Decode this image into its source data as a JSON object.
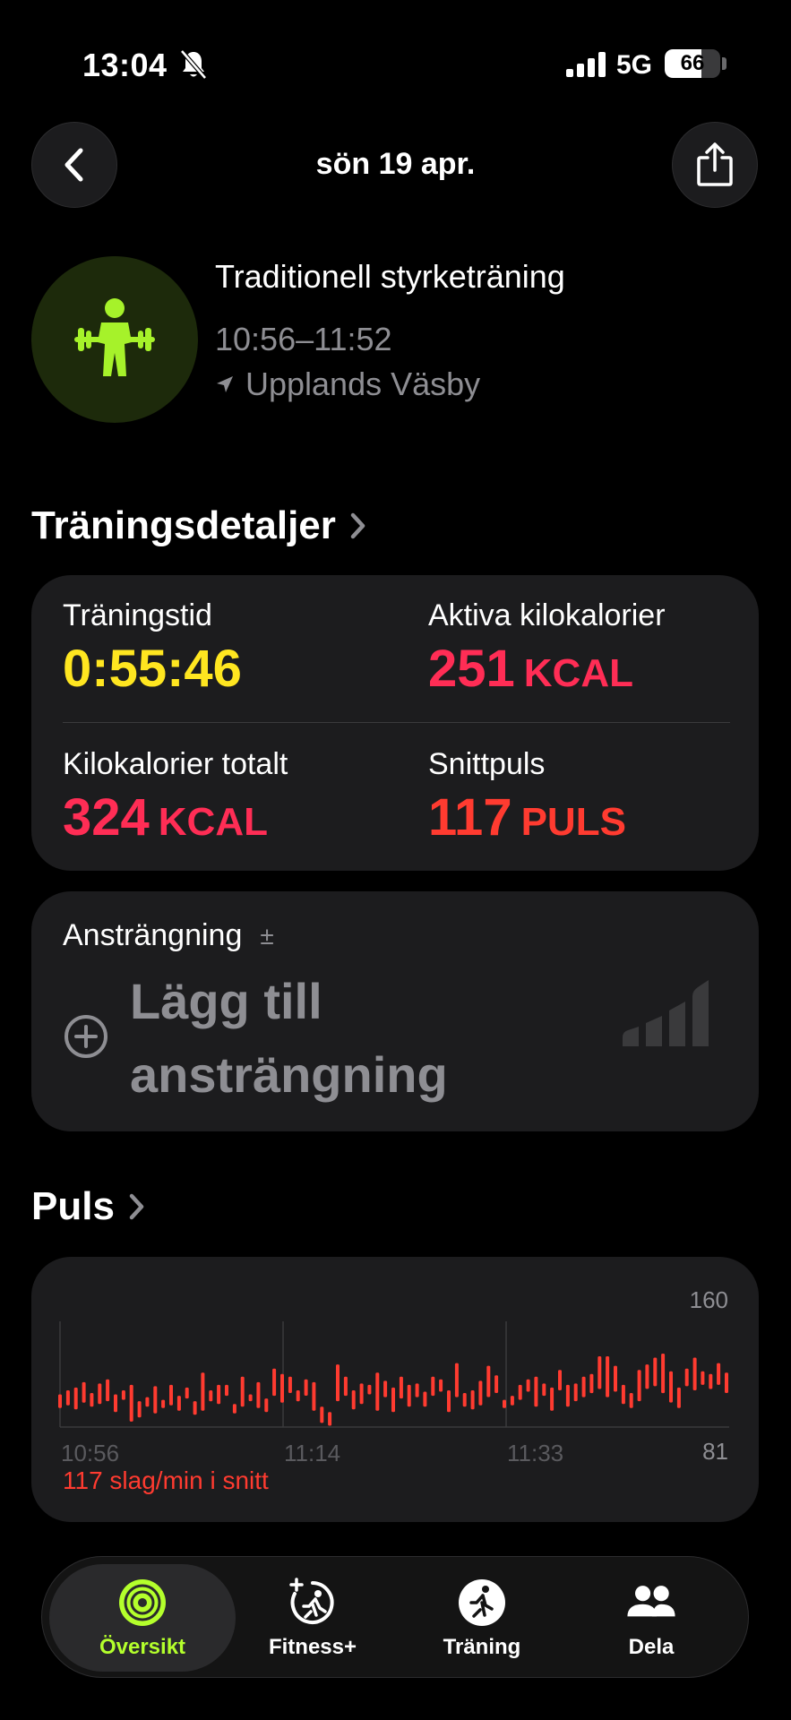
{
  "status_bar": {
    "time": "13:04",
    "network": "5G",
    "battery": "66",
    "battery_level": 0.66
  },
  "nav": {
    "title": "sön 19 apr."
  },
  "workout": {
    "name": "Traditionell styrketräning",
    "time_range": "10:56–11:52",
    "location": "Upplands Väsby"
  },
  "details": {
    "header": "Träningsdetaljer",
    "metrics": [
      {
        "label": "Träningstid",
        "value": "0:55:46",
        "unit": "",
        "color": "#ffe620"
      },
      {
        "label": "Aktiva kilokalorier",
        "value": "251",
        "unit": "KCAL",
        "color": "#ff2d55"
      },
      {
        "label": "Kilokalorier totalt",
        "value": "324",
        "unit": "KCAL",
        "color": "#ff2d55"
      },
      {
        "label": "Snittpuls",
        "value": "117",
        "unit": "PULS",
        "color": "#ff3b30"
      }
    ]
  },
  "effort": {
    "label": "Ansträngning",
    "plusminus": "±",
    "add_text": "Lägg till ansträngning"
  },
  "pulse": {
    "header": "Puls",
    "average_text": "117 slag/min i snitt",
    "chart_data": {
      "type": "bar",
      "y_max_label": "160",
      "y_min_label": "81",
      "ylim": [
        81,
        160
      ],
      "x_tick_labels": [
        "10:56",
        "11:14",
        "11:33"
      ],
      "series_color": "#ff3b30",
      "ranges": [
        [
          95,
          105
        ],
        [
          97,
          108
        ],
        [
          94,
          110
        ],
        [
          99,
          114
        ],
        [
          96,
          106
        ],
        [
          98,
          113
        ],
        [
          100,
          116
        ],
        [
          92,
          105
        ],
        [
          101,
          108
        ],
        [
          85,
          112
        ],
        [
          88,
          100
        ],
        [
          96,
          103
        ],
        [
          91,
          111
        ],
        [
          95,
          101
        ],
        [
          97,
          112
        ],
        [
          93,
          104
        ],
        [
          102,
          110
        ],
        [
          90,
          100
        ],
        [
          93,
          121
        ],
        [
          100,
          108
        ],
        [
          98,
          112
        ],
        [
          104,
          112
        ],
        [
          91,
          98
        ],
        [
          96,
          118
        ],
        [
          100,
          105
        ],
        [
          95,
          114
        ],
        [
          92,
          102
        ],
        [
          104,
          124
        ],
        [
          99,
          120
        ],
        [
          106,
          118
        ],
        [
          100,
          108
        ],
        [
          104,
          116
        ],
        [
          93,
          114
        ],
        [
          84,
          96
        ],
        [
          82,
          92
        ],
        [
          100,
          127
        ],
        [
          104,
          118
        ],
        [
          94,
          108
        ],
        [
          98,
          113
        ],
        [
          105,
          112
        ],
        [
          93,
          121
        ],
        [
          103,
          115
        ],
        [
          92,
          110
        ],
        [
          102,
          118
        ],
        [
          96,
          112
        ],
        [
          103,
          113
        ],
        [
          96,
          107
        ],
        [
          104,
          118
        ],
        [
          107,
          116
        ],
        [
          92,
          108
        ],
        [
          103,
          128
        ],
        [
          96,
          106
        ],
        [
          94,
          108
        ],
        [
          97,
          115
        ],
        [
          103,
          126
        ],
        [
          106,
          119
        ],
        [
          95,
          101
        ],
        [
          97,
          104
        ],
        [
          101,
          112
        ],
        [
          107,
          116
        ],
        [
          96,
          118
        ],
        [
          104,
          113
        ],
        [
          93,
          110
        ],
        [
          108,
          123
        ],
        [
          96,
          112
        ],
        [
          100,
          113
        ],
        [
          103,
          118
        ],
        [
          106,
          120
        ],
        [
          109,
          133
        ],
        [
          103,
          133
        ],
        [
          107,
          126
        ],
        [
          98,
          112
        ],
        [
          95,
          106
        ],
        [
          100,
          123
        ],
        [
          109,
          127
        ],
        [
          111,
          132
        ],
        [
          106,
          135
        ],
        [
          99,
          122
        ],
        [
          95,
          110
        ],
        [
          111,
          124
        ],
        [
          108,
          132
        ],
        [
          112,
          122
        ],
        [
          109,
          120
        ],
        [
          112,
          128
        ],
        [
          106,
          121
        ]
      ]
    }
  },
  "tabbar": {
    "tabs": [
      {
        "label": "Översikt",
        "active": true
      },
      {
        "label": "Fitness+",
        "active": false
      },
      {
        "label": "Träning",
        "active": false
      },
      {
        "label": "Dela",
        "active": false
      }
    ]
  },
  "colors": {
    "accent_green": "#b4ff2c",
    "card_bg": "#1c1c1e",
    "secondary_text": "#8e8e93"
  }
}
